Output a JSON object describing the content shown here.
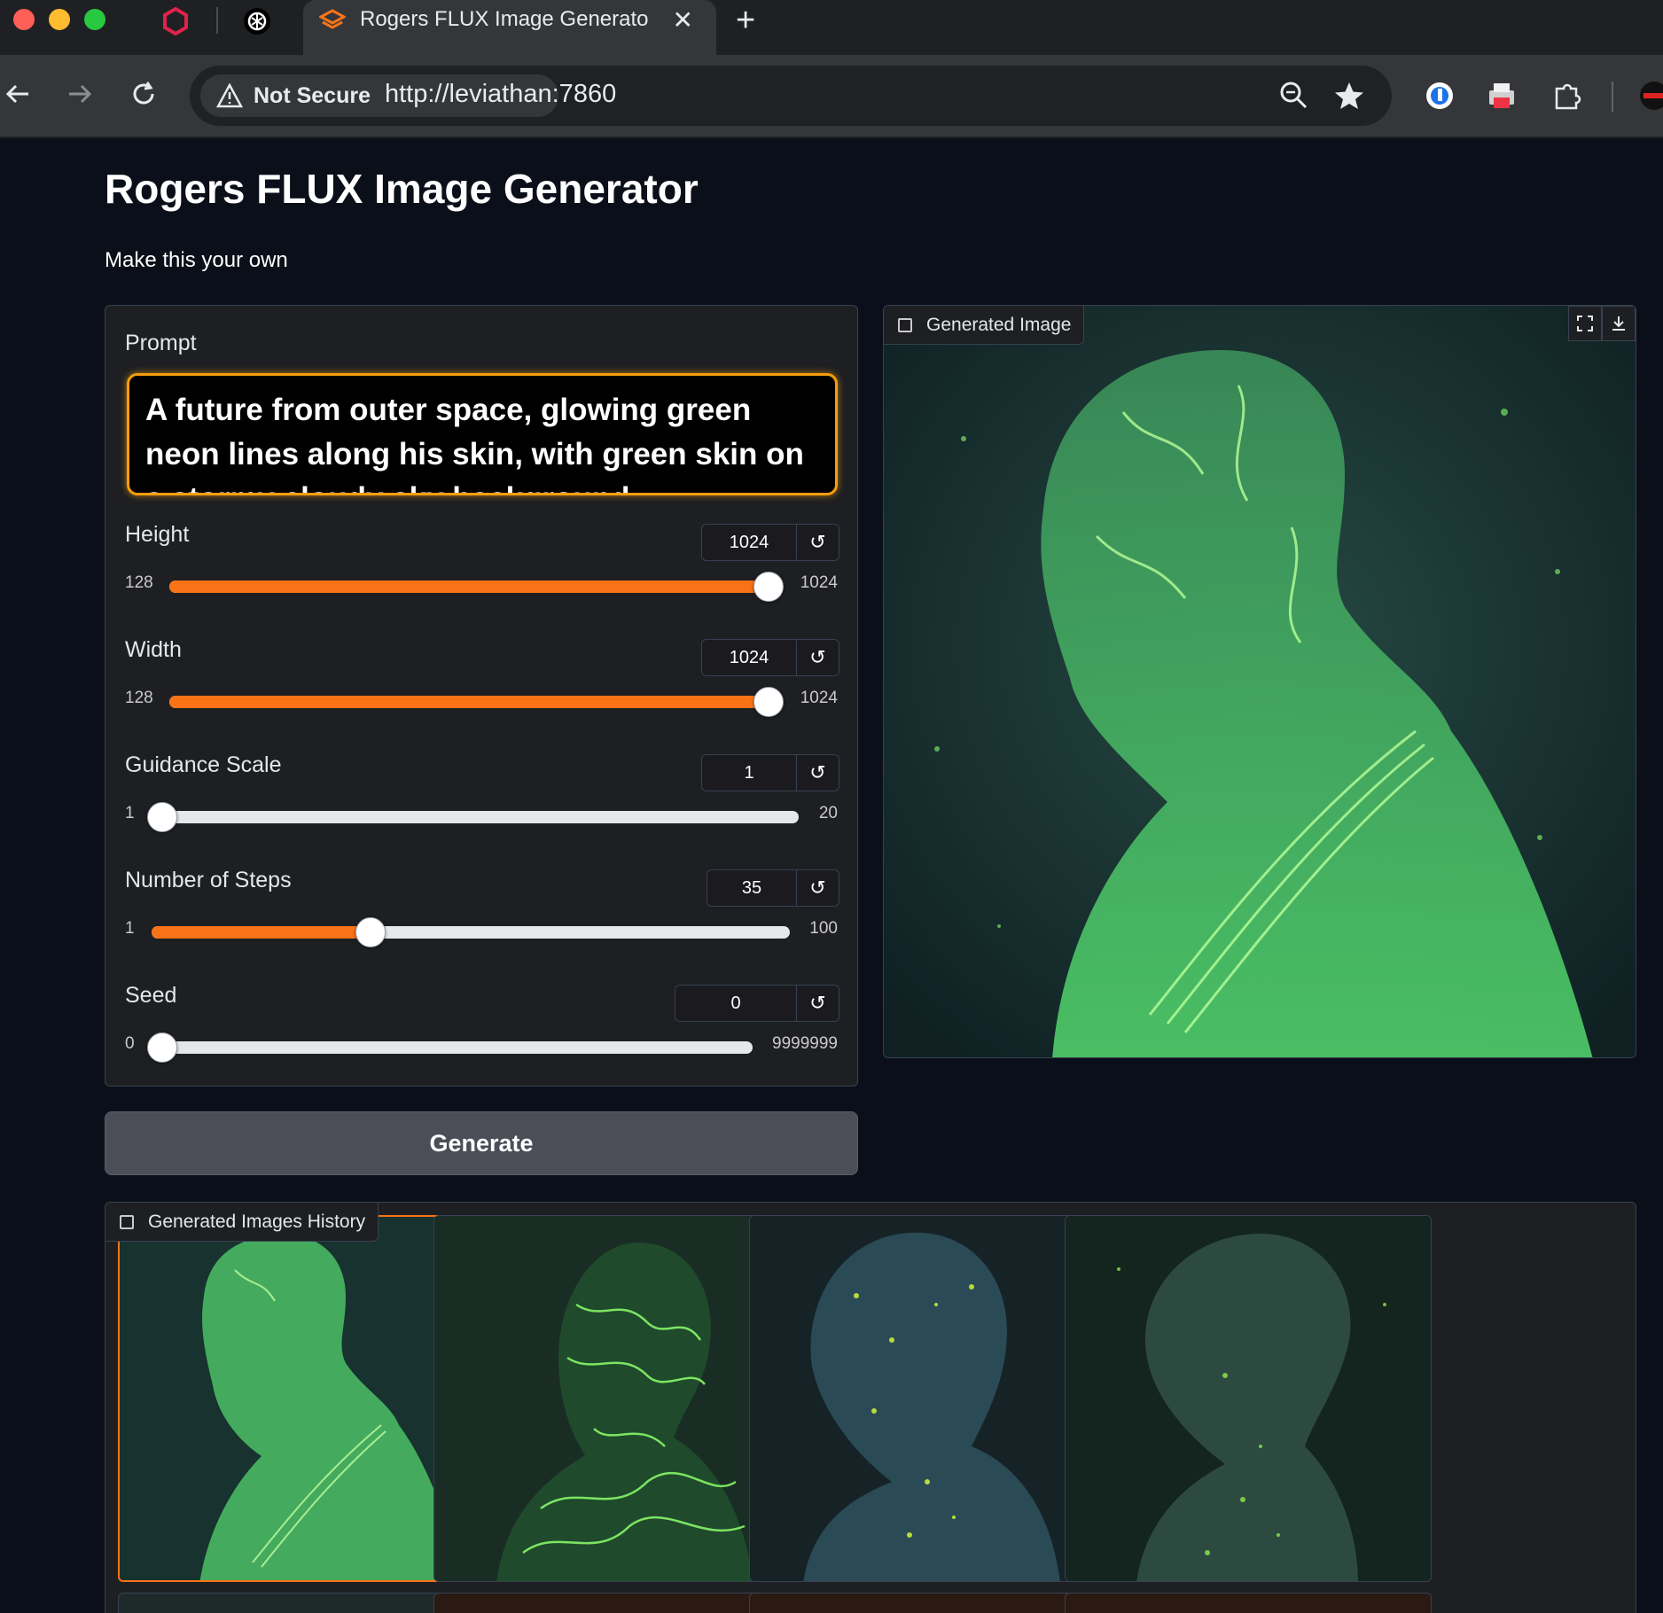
{
  "browser": {
    "tab_title": "Rogers FLUX Image Generato",
    "tab_close": "✕",
    "new_tab": "+",
    "security_label": "Not Secure",
    "url": "http://leviathan:7860"
  },
  "app": {
    "title": "Rogers FLUX Image Generator",
    "description": "Make this your own"
  },
  "prompt": {
    "label": "Prompt",
    "value": "A future from outer space, glowing green neon lines along his skin, with green skin on a stormy cloudy sky background"
  },
  "sliders": [
    {
      "label": "Height",
      "value": "1024",
      "min": "128",
      "max": "1024",
      "fraction": 1.0
    },
    {
      "label": "Width",
      "value": "1024",
      "min": "128",
      "max": "1024",
      "fraction": 1.0
    },
    {
      "label": "Guidance Scale",
      "value": "1",
      "min": "1",
      "max": "20",
      "fraction": 0.0
    },
    {
      "label": "Number of Steps",
      "value": "35",
      "min": "1",
      "max": "100",
      "fraction": 0.3434
    },
    {
      "label": "Seed",
      "value": "0",
      "min": "0",
      "max": "9999999",
      "fraction": 0.0
    }
  ],
  "generate_button": "Generate",
  "output": {
    "label": "Generated Image"
  },
  "history": {
    "label": "Generated Images History"
  },
  "colors": {
    "accent": "#f97316",
    "prompt_border": "#f59e0b",
    "background": "#0b0f19"
  }
}
